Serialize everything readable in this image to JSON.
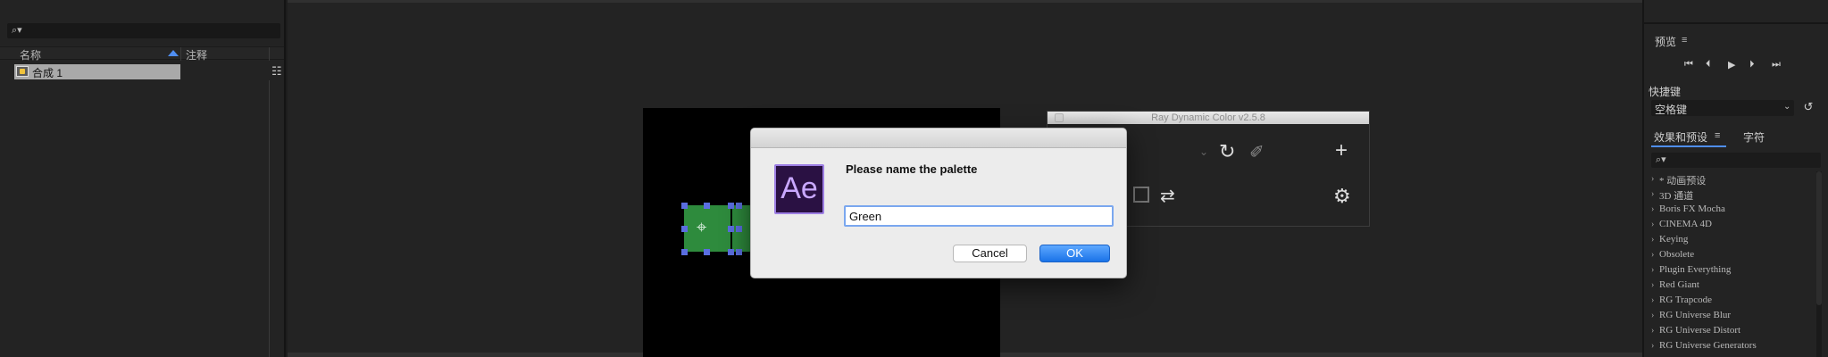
{
  "project_panel": {
    "search_icon": "search-icon",
    "columns": {
      "name": "名称",
      "note": "注释"
    },
    "items": [
      {
        "label": "合成 1",
        "icon": "composition-icon"
      }
    ],
    "flowchart_icon": "flowchart-icon"
  },
  "viewer": {
    "layer_color": "#2e8b3d",
    "handle_color": "#5a6ee0"
  },
  "ray_panel": {
    "title": "Ray Dynamic Color v2.5.8",
    "icons": [
      "refresh-icon",
      "eyedropper-icon",
      "plus-icon",
      "square-icon",
      "swap-icon",
      "gear-icon"
    ]
  },
  "dialog": {
    "message": "Please name the palette",
    "input_value": "Green",
    "cancel_label": "Cancel",
    "ok_label": "OK",
    "logo_text": "Ae"
  },
  "right_panel": {
    "preview_title": "预览",
    "shortcut_label": "快捷键",
    "shortcut_value": "空格键",
    "tabs": [
      "效果和预设",
      "字符"
    ],
    "effects": [
      "* 动画预设",
      "3D 通道",
      "Boris FX Mocha",
      "CINEMA 4D",
      "Keying",
      "Obsolete",
      "Plugin Everything",
      "Red Giant",
      "RG Trapcode",
      "RG Universe Blur",
      "RG Universe Distort",
      "RG Universe Generators"
    ]
  },
  "colors": {
    "accent": "#4f8ef2",
    "ok_button": "#1a73e8",
    "ae_purple": "#9d7fe4"
  }
}
